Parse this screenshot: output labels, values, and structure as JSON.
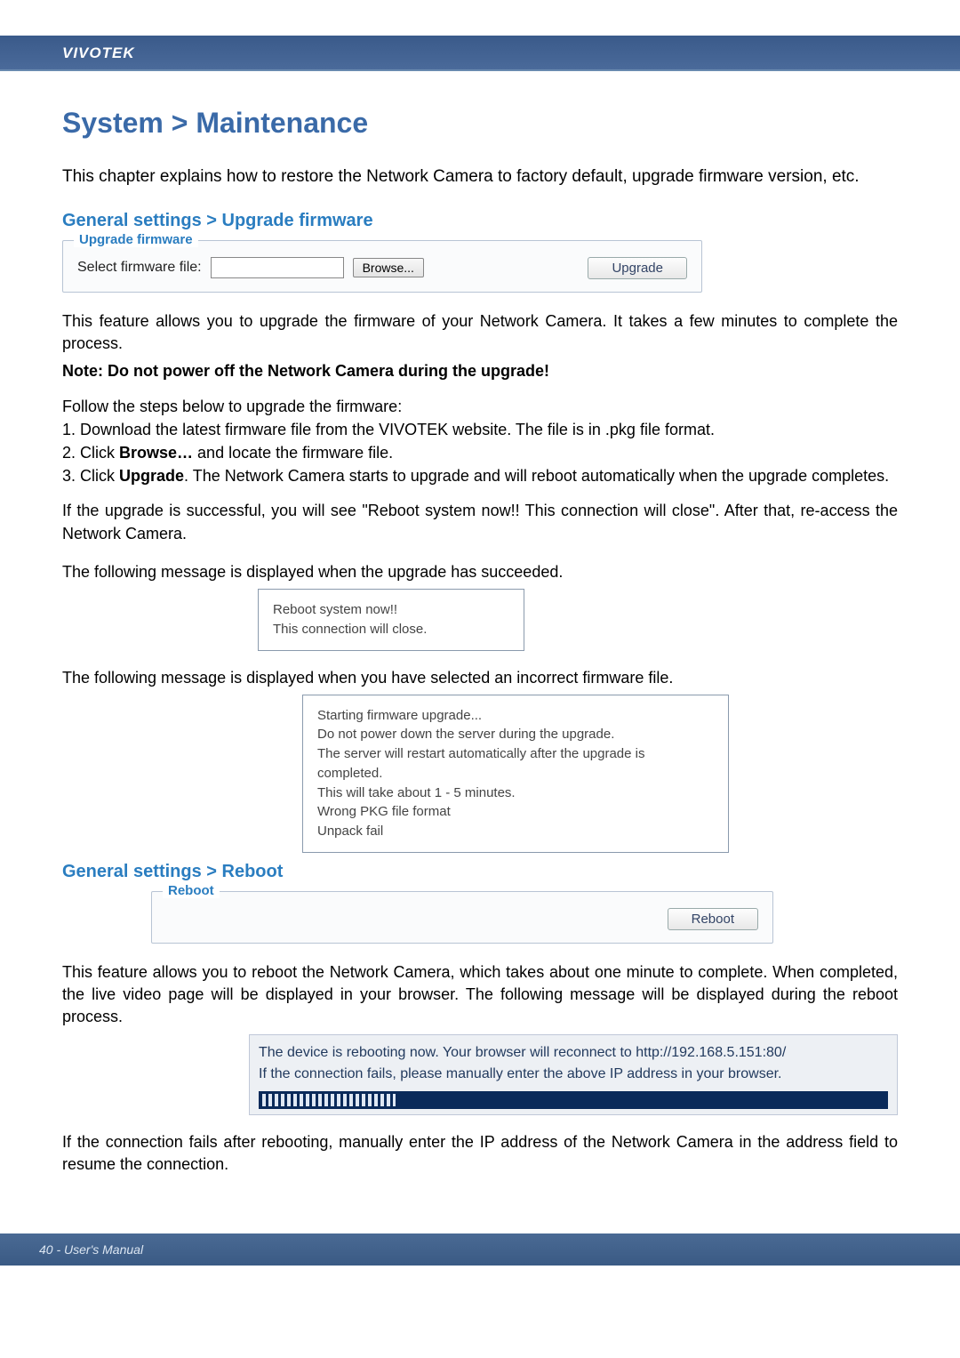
{
  "header": {
    "brand": "VIVOTEK"
  },
  "title": "System > Maintenance",
  "intro": "This chapter explains how to restore the Network Camera to factory default, upgrade firmware version, etc.",
  "sections": {
    "upgrade": {
      "heading": "General settings > Upgrade firmware",
      "legend": "Upgrade firmware",
      "label": "Select firmware file:",
      "browse": "Browse...",
      "upgrade_btn": "Upgrade",
      "desc1": "This feature allows you to upgrade the firmware of your Network Camera. It takes a few minutes to complete the process.",
      "note": "Note: Do not power off the Network Camera during the upgrade!",
      "steps_intro": "Follow the steps below to upgrade the firmware:",
      "step1": "1. Download the latest firmware file from the VIVOTEK website. The file is in .pkg file format.",
      "step2a": "2. Click ",
      "step2b": "Browse…",
      "step2c": " and locate the firmware file.",
      "step3a": "3. Click ",
      "step3b": "Upgrade",
      "step3c": ". The Network Camera starts to upgrade and will reboot automatically when the upgrade completes.",
      "success_para": "If the upgrade is successful, you will see \"Reboot system now!! This connection will close\". After that, re-access the Network Camera.",
      "succ_msg_intro": "The following message is displayed when the upgrade has succeeded.",
      "succ_box_l1": "Reboot system now!!",
      "succ_box_l2": "This connection will close.",
      "fail_msg_intro": "The following message is displayed when you have selected an incorrect firmware file.",
      "fail_box_l1": "Starting firmware upgrade...",
      "fail_box_l2": "Do not power down the server during the upgrade.",
      "fail_box_l3": "The server will restart automatically after the upgrade is completed.",
      "fail_box_l4": "This will take about 1 - 5 minutes.",
      "fail_box_l5": "Wrong PKG file format",
      "fail_box_l6": "Unpack fail"
    },
    "reboot": {
      "heading": "General settings > Reboot",
      "legend": "Reboot",
      "btn": "Reboot",
      "desc": "This feature allows you to reboot the Network Camera, which takes about one minute to complete. When completed, the live video page will be displayed in your browser. The following message will be displayed during the reboot process.",
      "msg1": "The device is rebooting now. Your browser will reconnect to http://192.168.5.151:80/",
      "msg2": "If the connection fails, please manually enter the above IP address in your browser.",
      "after": "If the connection fails after rebooting, manually enter the IP address of the Network Camera in the address field to resume the connection."
    }
  },
  "footer": "40 - User's Manual"
}
